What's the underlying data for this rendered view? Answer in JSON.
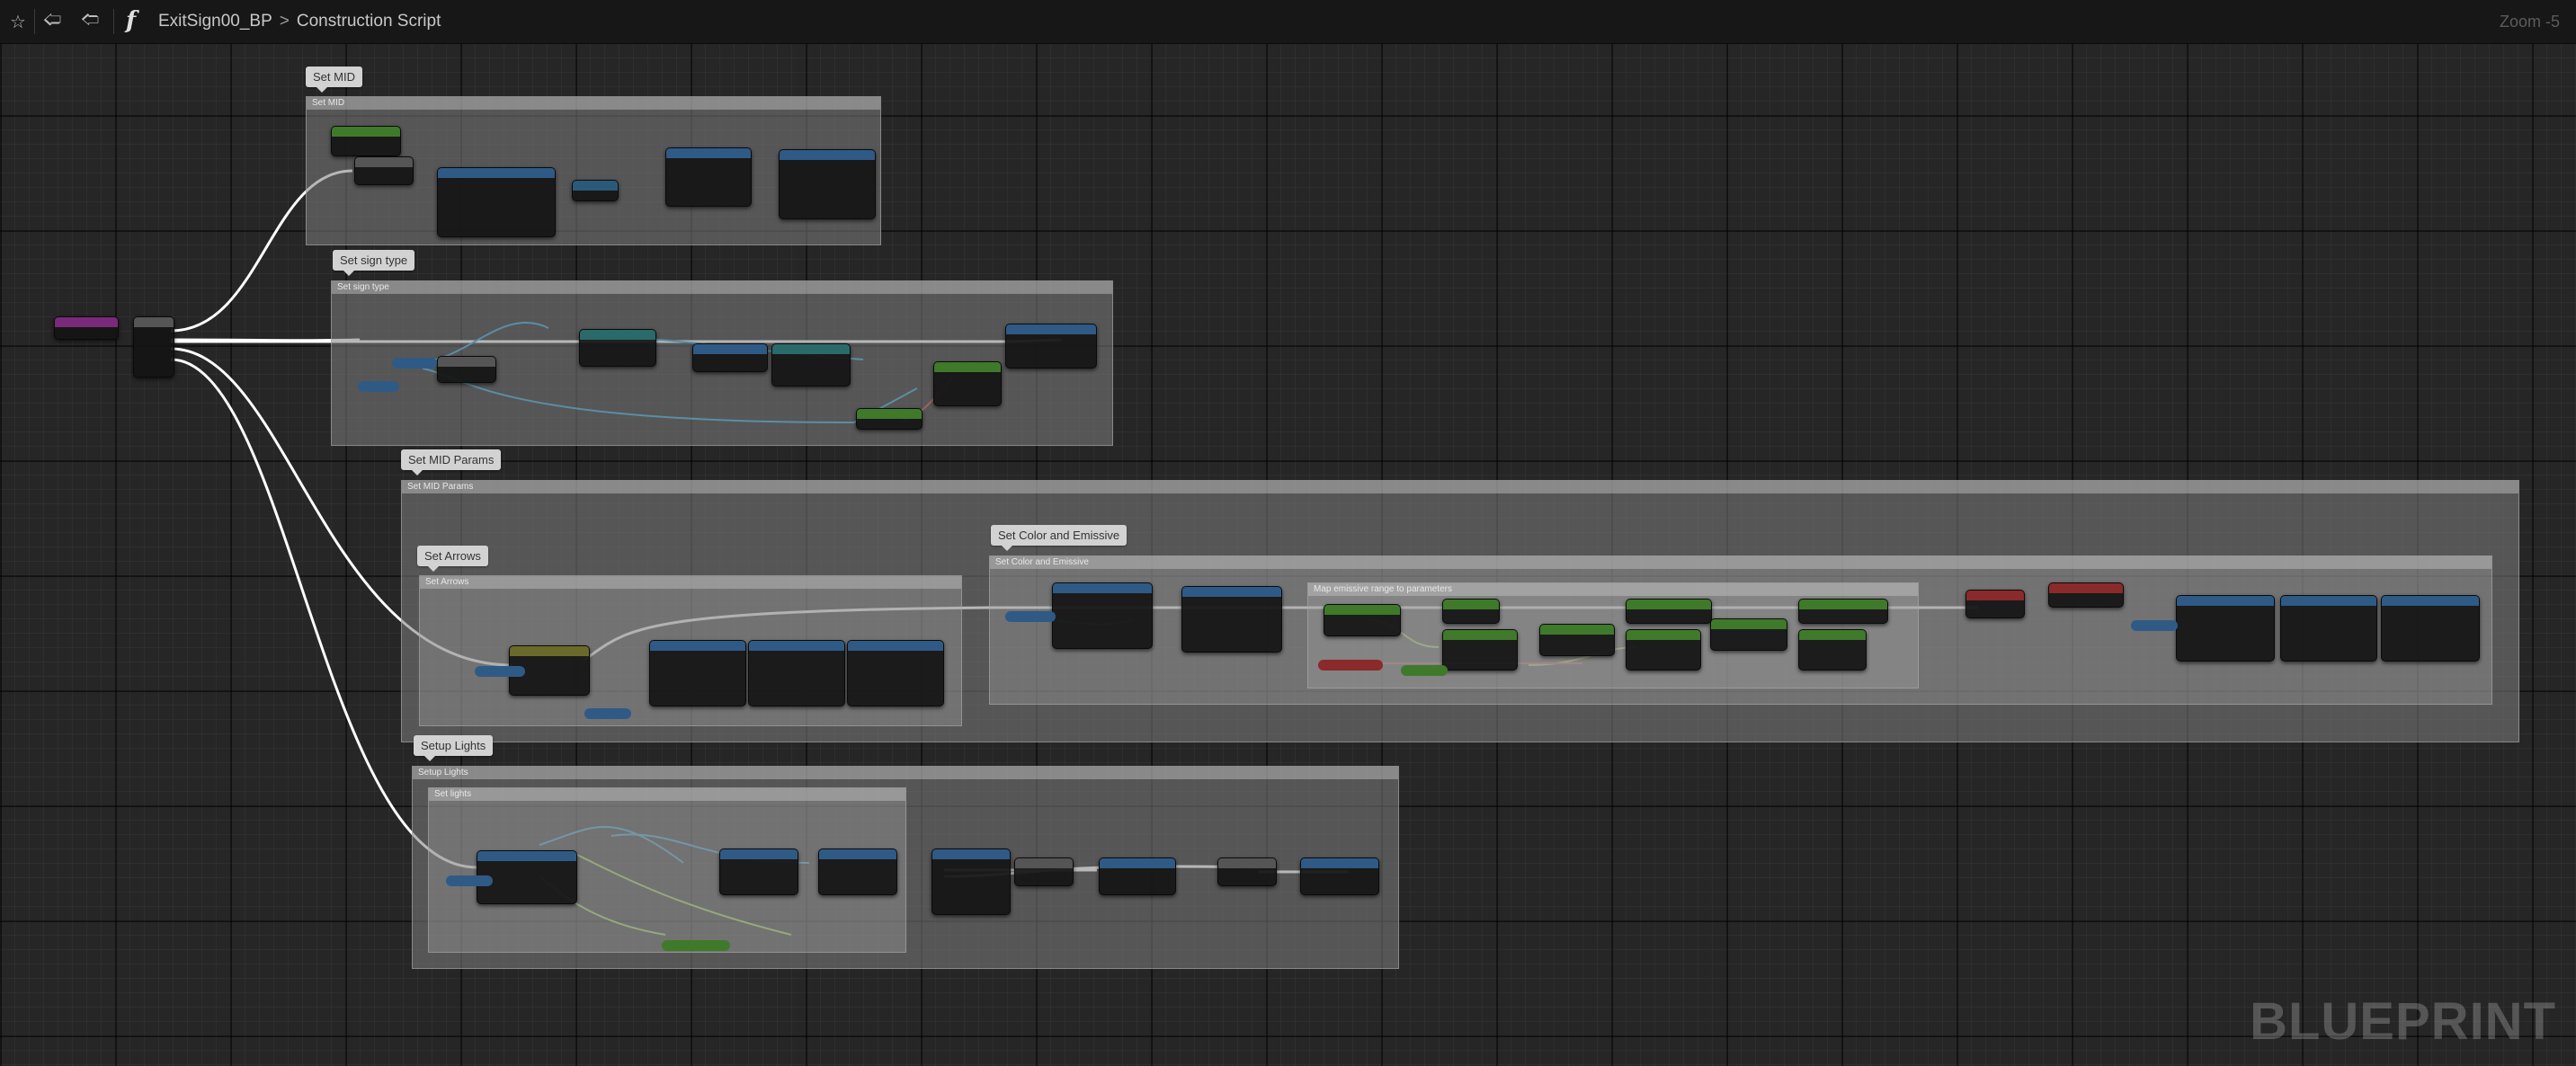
{
  "toolbar": {
    "breadcrumb_asset": "ExitSign00_BP",
    "breadcrumb_separator": ">",
    "breadcrumb_graph": "Construction Script",
    "function_icon": "f",
    "zoom": "Zoom -5",
    "icons": [
      "star-icon",
      "back-arrow-icon",
      "forward-arrow-icon",
      "function-icon"
    ]
  },
  "watermark": "BLUEPRINT",
  "comments": {
    "set_mid": "Set MID",
    "set_sign_type": "Set sign type",
    "set_mid_params": "Set MID Params",
    "set_arrows": "Set Arrows",
    "set_color_emissive": "Set Color and Emissive",
    "setup_lights": "Setup Lights"
  },
  "colors": {
    "background": "#262626",
    "toolbar": "#171717",
    "exec_wire": "#ffffff",
    "object_wire": "#2fa3d8",
    "float_wire": "#a3e34a",
    "struct_wire": "#2b6fb3",
    "node_header_function": "#2f5a86",
    "node_header_event": "#7a2a7a",
    "node_header_green": "#3e7a2a",
    "node_header_red": "#8a2a2a"
  }
}
